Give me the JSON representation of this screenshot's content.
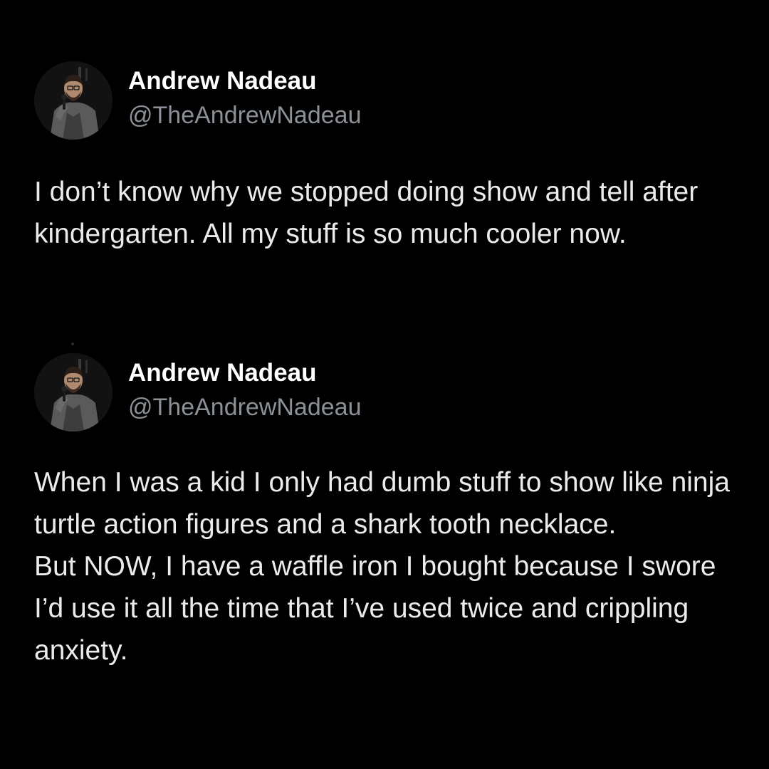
{
  "tweets": [
    {
      "display_name": "Andrew Nadeau",
      "handle": "@TheAndrewNadeau",
      "avatar_icon": "avatar-comedian-with-microphone",
      "paragraphs": [
        "I don’t know why we stopped doing show and tell after kindergarten. All my stuff is so much cooler now."
      ]
    },
    {
      "display_name": "Andrew Nadeau",
      "handle": "@TheAndrewNadeau",
      "avatar_icon": "avatar-comedian-with-microphone",
      "paragraphs": [
        "When I was a kid I only had dumb stuff to show like ninja turtle action figures and a shark tooth necklace.",
        "But NOW, I have a waffle iron I bought because I swore I’d use it all the time that I’ve used twice and crippling anxiety."
      ]
    }
  ],
  "colors": {
    "background": "#000000",
    "name": "#ffffff",
    "handle": "#8b9196",
    "text": "#ebebeb"
  }
}
